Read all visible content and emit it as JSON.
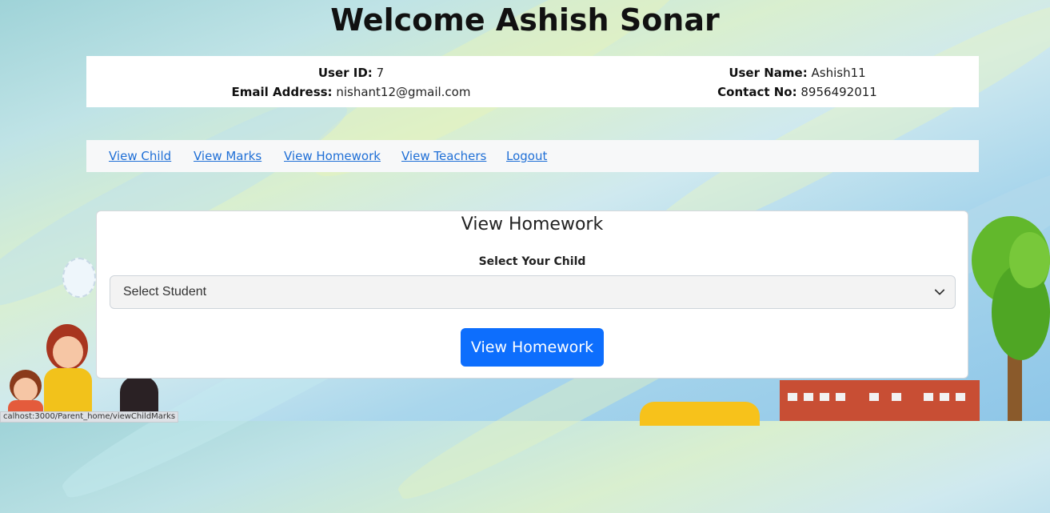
{
  "header": {
    "title": "Welcome Ashish Sonar"
  },
  "user_info": {
    "user_id_label": "User ID:",
    "user_id_value": "7",
    "email_label": "Email Address:",
    "email_value": "nishant12@gmail.com",
    "user_name_label": "User Name:",
    "user_name_value": "Ashish11",
    "contact_label": "Contact No:",
    "contact_value": "8956492011"
  },
  "nav": {
    "items": [
      {
        "label": "View Child"
      },
      {
        "label": "View Marks"
      },
      {
        "label": "View Homework"
      },
      {
        "label": "View Teachers"
      },
      {
        "label": "Logout"
      }
    ]
  },
  "card": {
    "title": "View Homework",
    "select_label": "Select Your Child",
    "select_value": "Select Student",
    "submit_label": "View Homework"
  },
  "status_bar": {
    "url": "calhost:3000/Parent_home/viewChildMarks"
  },
  "colors": {
    "primary": "#0d6efd",
    "link": "#1f6fd6"
  }
}
